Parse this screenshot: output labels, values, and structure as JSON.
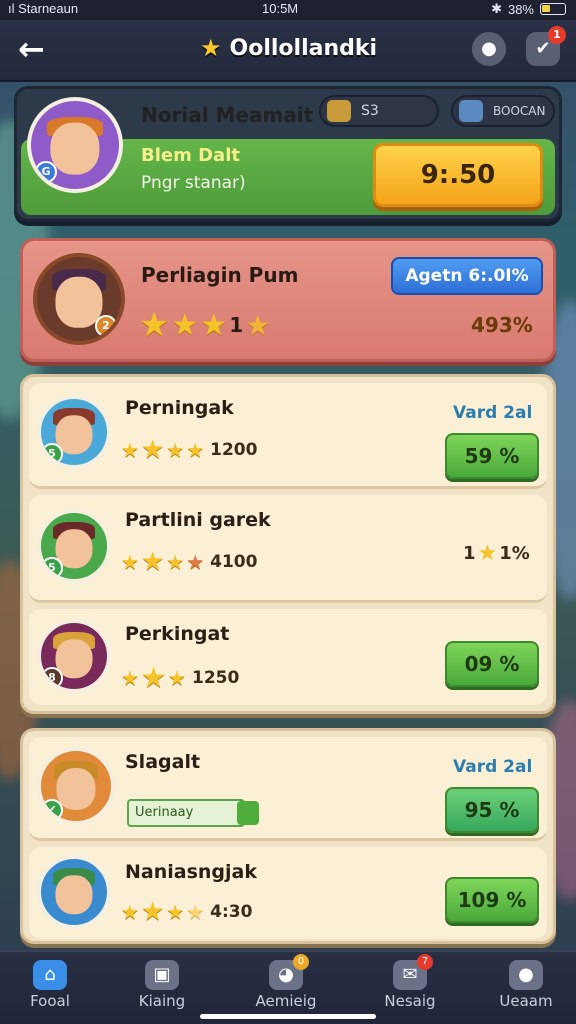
{
  "status_bar": {
    "carrier": "ıl Starneaun",
    "time": "10:5M",
    "battery": "38%"
  },
  "header": {
    "title": "Oollollandki",
    "notification_count": "1"
  },
  "player": {
    "name": "Norial Meamait",
    "stat1": "S3",
    "stat2": "BOOCAN",
    "line1": "Blem Dalt",
    "line2": "Pngr stanar)",
    "button": "9:.50"
  },
  "featured": {
    "name": "Perliagin Pum",
    "stars": "1",
    "button": "Agetn 6:.0I%",
    "percent": "493%"
  },
  "list1": [
    {
      "name": "Perningak",
      "score": "1200",
      "tag": "Vard 2al",
      "button": "59 %"
    },
    {
      "name": "Partlini garek",
      "score": "4100",
      "percent": "1%",
      "percent_prefix": "1"
    },
    {
      "name": "Perkingat",
      "score": "1250",
      "button": "09 %"
    }
  ],
  "list2": [
    {
      "name": "Slagalt",
      "tag": "Vard 2al",
      "unlock": "Uerinaay",
      "button": "95 %"
    },
    {
      "name": "Naniasngjak",
      "score": "4:30",
      "button": "109 %"
    }
  ],
  "nav": [
    {
      "label": "Fooal",
      "icon": "home-icon"
    },
    {
      "label": "Kiaing",
      "icon": "chat-icon"
    },
    {
      "label": "Aemieig",
      "icon": "pet-icon",
      "badge": "0"
    },
    {
      "label": "Nesaig",
      "icon": "gift-icon",
      "badge": "7"
    },
    {
      "label": "Ueaam",
      "icon": "message-icon"
    }
  ]
}
